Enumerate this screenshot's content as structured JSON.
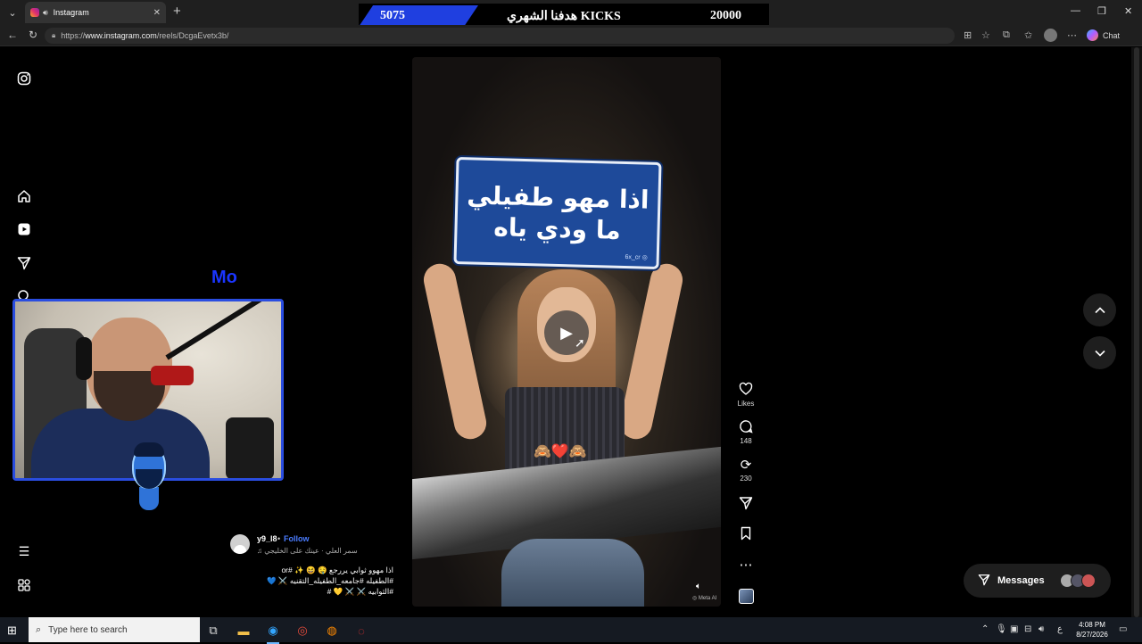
{
  "browser": {
    "tab_title": "Instagram",
    "url_prefix": "https://",
    "url_host": "www.instagram.com",
    "url_path": "/reels/DcgaEvetx3b/",
    "chat_label": "Chat"
  },
  "stream_banner": {
    "current": "5075",
    "goal_text": "هدفنا الشهري KICKS",
    "target": "20000"
  },
  "overlay": {
    "mo_text": "Mo"
  },
  "reel": {
    "sign_line1": "اذا مهو طفيلي",
    "sign_line2": "ما ودي ياه",
    "sign_tag": "6x_cr ◎",
    "emojis": "🙈❤️🙈",
    "watermark": "◎ Meta AI"
  },
  "actions": {
    "likes_label": "Likes",
    "comments_count": "148",
    "reposts_count": "230"
  },
  "caption": {
    "username": "y9_l8",
    "separator": "•",
    "follow_label": "Follow",
    "audio": "سمر العلي · عينك على الخليجي ♫",
    "lines": [
      "اذا مهوو ثوابي يررجع 🤤 😆 ✨ #or",
      "#الطفيله #جامعه_الطفيله_التقنيه ⚔️ 💙",
      "#الثوابيه ⚔️ ⚔️ 💛 #"
    ]
  },
  "messages": {
    "label": "Messages"
  },
  "taskbar": {
    "search_placeholder": "Type here to search",
    "ime": "ع",
    "time": "4:08 PM",
    "date": "8/27/2026"
  },
  "colors": {
    "accent_blue": "#1a35ff",
    "follow_blue": "#4a7cff",
    "webcam_border": "#2a4de0"
  },
  "icons": [
    "instagram-icon",
    "home-icon",
    "reels-icon",
    "send-icon",
    "search-icon",
    "menu-icon",
    "more-icon",
    "heart-icon",
    "comment-icon",
    "repost-icon",
    "share-icon",
    "bookmark-icon",
    "play-icon",
    "chevron-up-icon",
    "chevron-down-icon"
  ]
}
